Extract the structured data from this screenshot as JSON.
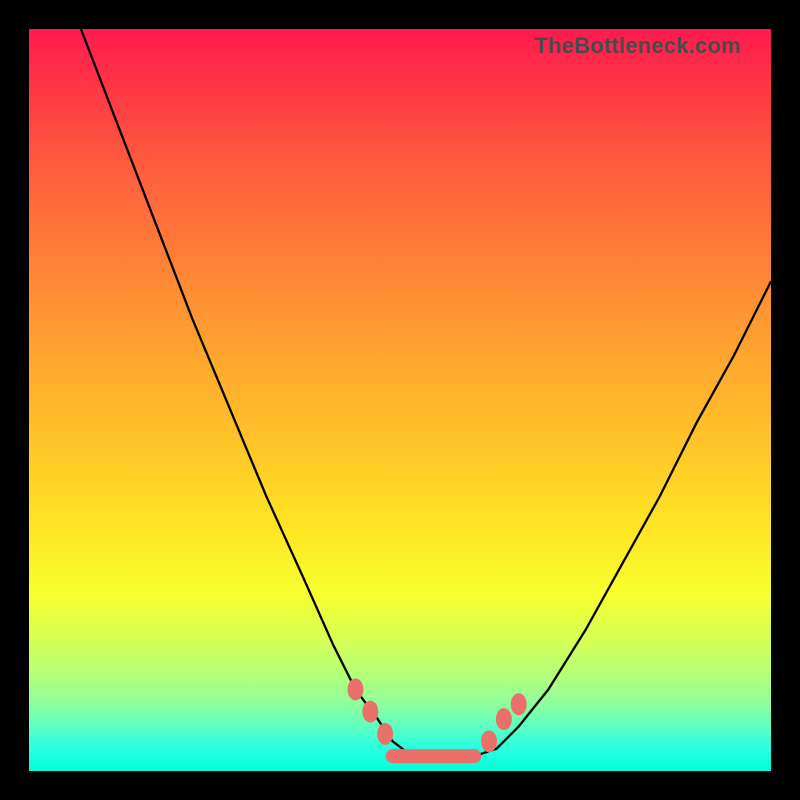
{
  "site": {
    "watermark": "TheBottleneck.com"
  },
  "chart_data": {
    "type": "line",
    "title": "TheBottleneck.com",
    "xlabel": "",
    "ylabel": "",
    "xlim": [
      0,
      100
    ],
    "ylim": [
      0,
      100
    ],
    "series": [
      {
        "name": "left-curve",
        "x": [
          7,
          12,
          17,
          22,
          27,
          32,
          37,
          41,
          44,
          47,
          49,
          51,
          53
        ],
        "y": [
          100,
          87,
          74,
          61,
          49,
          37,
          26,
          17,
          11,
          7,
          4,
          2.5,
          2
        ]
      },
      {
        "name": "right-curve",
        "x": [
          60,
          63,
          66,
          70,
          75,
          80,
          85,
          90,
          95,
          100
        ],
        "y": [
          2,
          3,
          6,
          11,
          19,
          28,
          37,
          47,
          56,
          66
        ]
      }
    ],
    "markers": {
      "left_curve_points": [
        {
          "x": 44,
          "y": 11
        },
        {
          "x": 46,
          "y": 8
        },
        {
          "x": 48,
          "y": 5
        }
      ],
      "right_curve_points": [
        {
          "x": 62,
          "y": 4
        },
        {
          "x": 64,
          "y": 7
        },
        {
          "x": 66,
          "y": 9
        }
      ],
      "bottom_track": {
        "x_start": 49,
        "x_end": 60,
        "y": 2
      }
    },
    "colors": {
      "curve": "#000000",
      "marker": "#e97169",
      "gradient_top": "#ff1a4e",
      "gradient_bottom": "#00ffd8"
    }
  }
}
